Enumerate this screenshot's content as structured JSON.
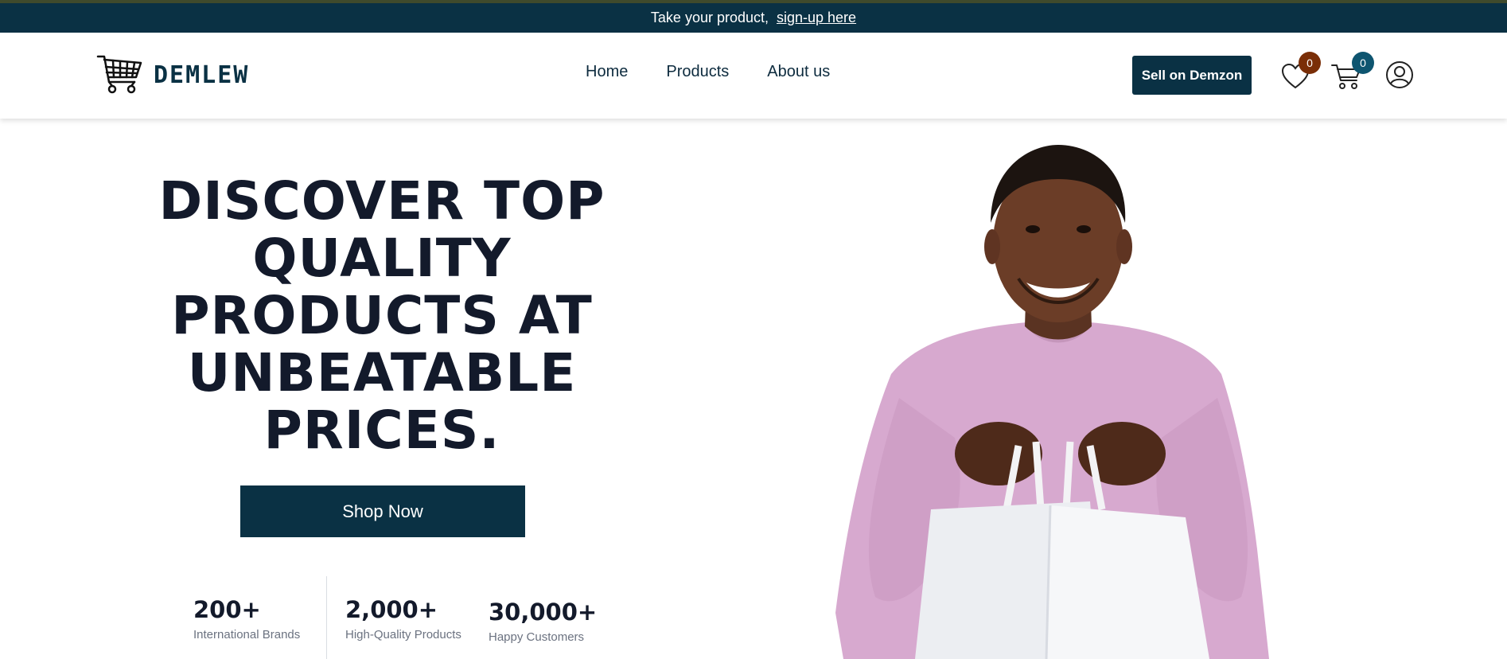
{
  "topbar": {
    "message": "Take your product,",
    "link_text": "sign-up here",
    "colors": {
      "background": "#0a3144"
    }
  },
  "header": {
    "logo_text": "DEMLEW",
    "nav": [
      {
        "label": "Home"
      },
      {
        "label": "Products"
      },
      {
        "label": "About us"
      }
    ],
    "sell_button": "Sell on Demzon",
    "wishlist_count": "0",
    "cart_count": "0",
    "icons": {
      "logo": "shopping-cart-icon",
      "wishlist": "heart-icon",
      "cart": "cart-icon",
      "account": "user-icon"
    },
    "colors": {
      "wishlist_badge": "#7a2e07",
      "cart_badge": "#0e5570"
    }
  },
  "hero": {
    "title": "DISCOVER TOP QUALITY PRODUCTS AT UNBEATABLE PRICES.",
    "cta": "Shop Now",
    "stats": [
      {
        "value": "200+",
        "label": "International Brands"
      },
      {
        "value": "2,000+",
        "label": "High-Quality Products"
      },
      {
        "value": "30,000+",
        "label": "Happy Customers"
      }
    ],
    "colors": {
      "accent": "#0a3144",
      "sweater": "#d7a9cf"
    }
  }
}
